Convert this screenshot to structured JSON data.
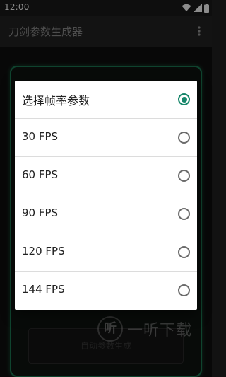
{
  "status_bar": {
    "time": "12:00",
    "icons": [
      "wifi-icon",
      "signal-icon",
      "battery-icon"
    ]
  },
  "app_bar": {
    "title": "刀剑参数生成器",
    "menu_icon": "more-vert-icon"
  },
  "background": {
    "button_label": "自动参数生成"
  },
  "dialog": {
    "options": [
      {
        "label": "选择帧率参数",
        "selected": true
      },
      {
        "label": "30 FPS",
        "selected": false
      },
      {
        "label": "60 FPS",
        "selected": false
      },
      {
        "label": "90 FPS",
        "selected": false
      },
      {
        "label": "120 FPS",
        "selected": false
      },
      {
        "label": "144 FPS",
        "selected": false
      }
    ]
  },
  "watermark": {
    "logo_text": "听",
    "text": "一听下载"
  },
  "colors": {
    "accent": "#16866a",
    "glow_border": "#1d7a55",
    "app_bar": "#242424"
  }
}
